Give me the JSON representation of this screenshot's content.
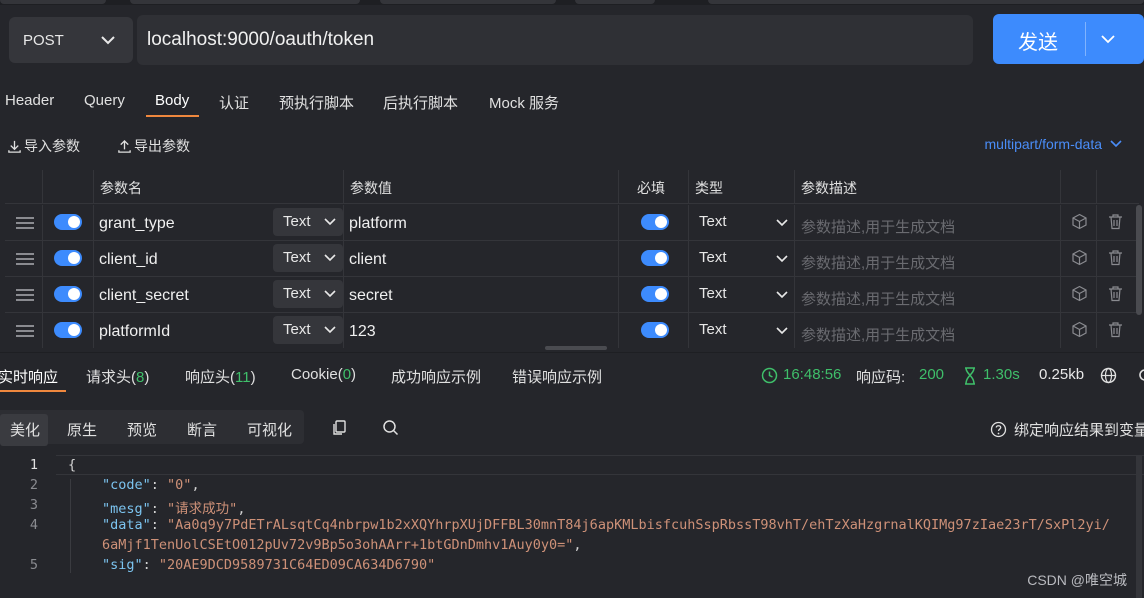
{
  "request": {
    "method": "POST",
    "url": "localhost:9000/oauth/token",
    "send_label": "发送"
  },
  "tabs": [
    {
      "label": "Header"
    },
    {
      "label": "Query"
    },
    {
      "label": "Body"
    },
    {
      "label": "认证"
    },
    {
      "label": "预执行脚本"
    },
    {
      "label": "后执行脚本"
    },
    {
      "label": "Mock 服务"
    }
  ],
  "active_tab": "Body",
  "toolbar": {
    "import_label": "导入参数",
    "export_label": "导出参数",
    "content_type": "multipart/form-data"
  },
  "params": {
    "headers": {
      "name": "参数名",
      "value": "参数值",
      "required": "必填",
      "type": "类型",
      "desc": "参数描述"
    },
    "rows": [
      {
        "name": "grant_type",
        "value_type": "Text",
        "value": "platform",
        "required": true,
        "field_type": "Text",
        "desc_placeholder": "参数描述,用于生成文档"
      },
      {
        "name": "client_id",
        "value_type": "Text",
        "value": "client",
        "required": true,
        "field_type": "Text",
        "desc_placeholder": "参数描述,用于生成文档"
      },
      {
        "name": "client_secret",
        "value_type": "Text",
        "value": "secret",
        "required": true,
        "field_type": "Text",
        "desc_placeholder": "参数描述,用于生成文档"
      },
      {
        "name": "platformId",
        "value_type": "Text",
        "value": "123",
        "required": true,
        "field_type": "Text",
        "desc_placeholder": "参数描述,用于生成文档"
      }
    ]
  },
  "response_tabs": {
    "realtime": "实时响应",
    "req_headers": "请求头(",
    "req_headers_count": "8",
    "resp_headers": "响应头(",
    "resp_headers_count": "11",
    "cookie": "Cookie(",
    "cookie_count": "0",
    "close_paren": ")",
    "success_example": "成功响应示例",
    "error_example": "错误响应示例"
  },
  "status": {
    "time": "16:48:56",
    "code_label": "响应码:",
    "code": "200",
    "duration": "1.30s",
    "size": "0.25kb"
  },
  "view_modes": [
    "美化",
    "原生",
    "预览",
    "断言",
    "可视化"
  ],
  "active_view": "美化",
  "bind_label": "绑定响应结果到变量",
  "code": {
    "line_numbers": [
      "1",
      "2",
      "3",
      "4",
      "",
      "5"
    ],
    "open_brace": "{",
    "code_key": "\"code\"",
    "code_val": "\"0\"",
    "mesg_key": "\"mesg\"",
    "mesg_val": "\"请求成功\"",
    "data_key": "\"data\"",
    "data_val_1": "\"Aa0q9y7PdETrALsqtCq4nbrpw1b2xXQYhrpXUjDFFBL30mnT84j6apKMLbisfcuhSspRbssT98vhT/ehTzXaHzgrnalKQIMg97zIae23rT/SxPl2yi/",
    "data_val_2": "6aMjf1TenUolCSEtO012pUv72v9Bp5o3ohAArr+1btGDnDmhv1Auy0y0=\"",
    "sig_key": "\"sig\"",
    "sig_val": "\"20AE9DCD9589731C64ED09CA634D6790\""
  },
  "watermark": "CSDN @唯空城",
  "colors": {
    "accent": "#3d8bfd",
    "tab_underline": "#f0883e",
    "success": "#3fbf6a"
  }
}
